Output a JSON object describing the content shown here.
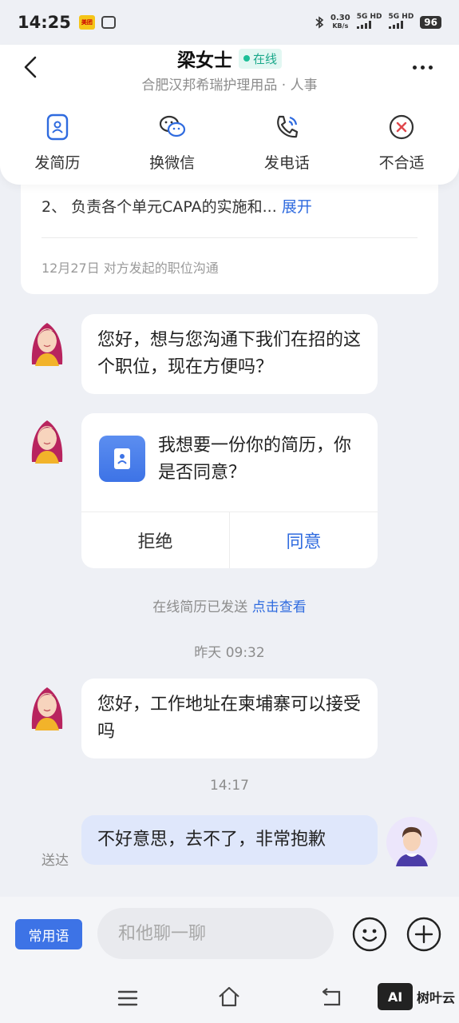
{
  "status_bar": {
    "time": "14:25",
    "net_speed_value": "0.30",
    "net_speed_unit": "KB/s",
    "sim1": "5G HD",
    "sim2": "5G HD",
    "battery": "96"
  },
  "header": {
    "contact_name": "梁女士",
    "online_status": "在线",
    "company_role": "合肥汉邦希瑞护理用品 · 人事",
    "actions": [
      {
        "label": "发简历",
        "icon": "resume-icon"
      },
      {
        "label": "换微信",
        "icon": "wechat-icon"
      },
      {
        "label": "发电话",
        "icon": "phone-icon"
      },
      {
        "label": "不合适",
        "icon": "reject-icon"
      }
    ]
  },
  "job_card": {
    "duty_line": "2、 负责各个单元CAPA的实施和...",
    "expand_label": "展开",
    "meta": "12月27日  对方发起的职位沟通"
  },
  "messages": {
    "m1": "您好，想与您沟通下我们在招的这个职位，现在方便吗？",
    "resume_request_text": "我想要一份你的简历，你是否同意？",
    "reject_label": "拒绝",
    "accept_label": "同意",
    "resume_sent_note": "在线简历已发送",
    "view_link": "点击查看",
    "time1": "昨天 09:32",
    "m2": "您好，工作地址在柬埔寨可以接受吗",
    "time2": "14:17",
    "m3": "不好意思，去不了，非常抱歉",
    "delivered": "送达"
  },
  "input_bar": {
    "phrases_label": "常用语",
    "placeholder": "和他聊一聊"
  },
  "watermark": {
    "logo": "AI",
    "text": "树叶云"
  },
  "colors": {
    "accent": "#3d73e6",
    "online": "#1dbf98",
    "background": "#eef0f5"
  }
}
